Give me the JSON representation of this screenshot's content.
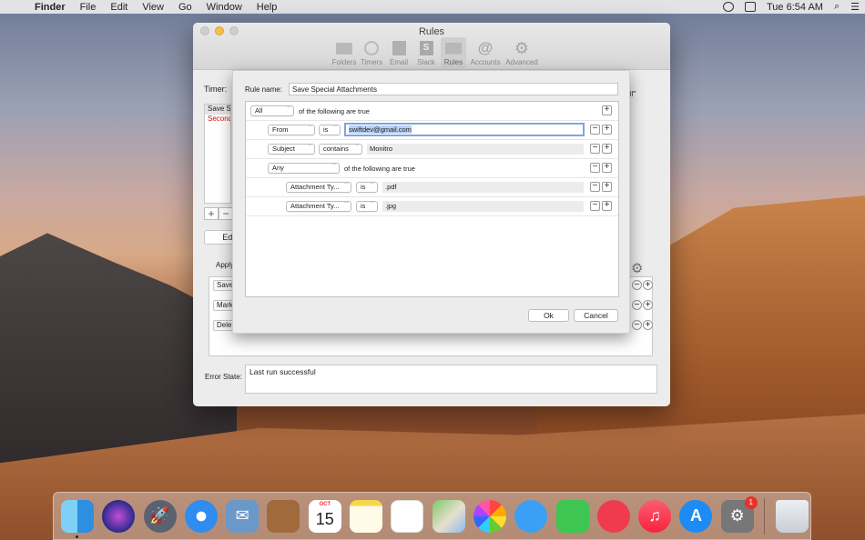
{
  "menubar": {
    "app": "Finder",
    "menus": [
      "File",
      "Edit",
      "View",
      "Go",
      "Window",
      "Help"
    ],
    "clock": "Tue 6:54 AM"
  },
  "window": {
    "title": "Rules",
    "toolbar": [
      "Folders",
      "Timers",
      "Email",
      "Slack",
      "Rules",
      "Accounts",
      "Advanced"
    ],
    "timer_label": "Timer:",
    "rules_list": [
      "Save Sp",
      "Second"
    ],
    "edit_label": "Edit",
    "apply_label": "Apply",
    "actions": [
      "Save",
      "Mark",
      "Dele"
    ],
    "pdf_hint": "df\"",
    "error_label": "Error State:",
    "error_text": "Last run successful"
  },
  "sheet": {
    "rule_name_label": "Rule name:",
    "rule_name_value": "Save Special Attachments",
    "row_all": {
      "match": "All",
      "suffix": "of the following are true"
    },
    "row_from": {
      "field": "From",
      "op": "is",
      "value": "swiftdev@gmail.com"
    },
    "row_subject": {
      "field": "Subject",
      "op": "contains",
      "value": "Monitro"
    },
    "row_any": {
      "match": "Any",
      "suffix": "of the following are true"
    },
    "row_att1": {
      "field": "Attachment Ty...",
      "op": "is",
      "value": ".pdf"
    },
    "row_att2": {
      "field": "Attachment Ty...",
      "op": "is",
      "value": ".jpg"
    },
    "ok_label": "Ok",
    "cancel_label": "Cancel"
  },
  "dock": {
    "calendar_month": "OCT",
    "calendar_day": "15",
    "preferences_badge": "1"
  }
}
